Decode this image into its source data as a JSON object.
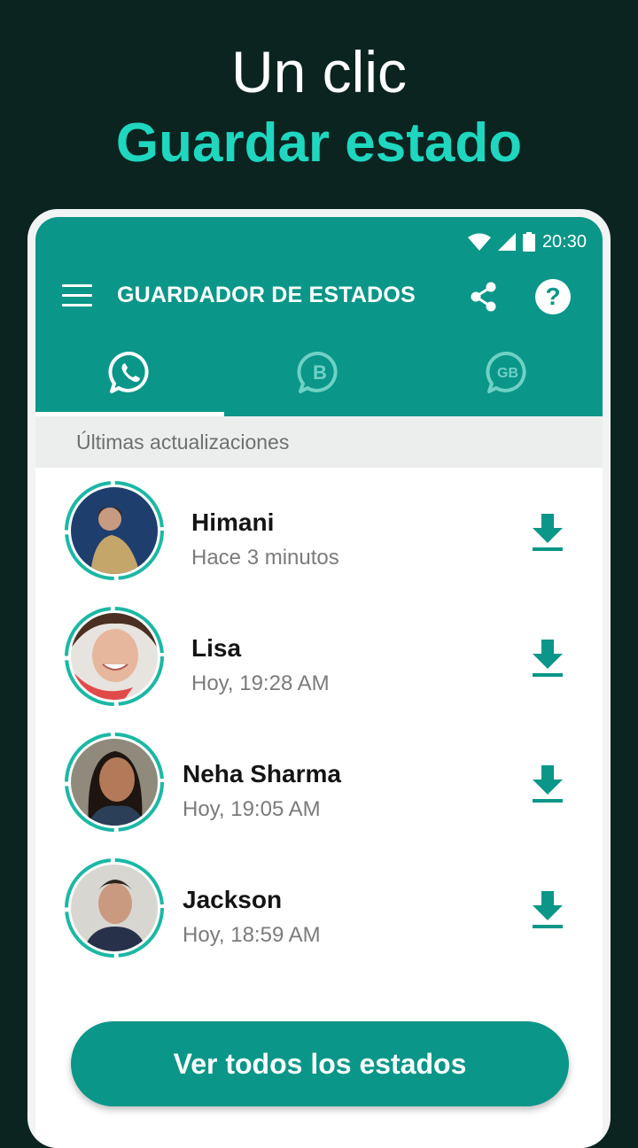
{
  "headline": {
    "line1": "Un clic",
    "line2": "Guardar estado"
  },
  "status_bar": {
    "time": "20:30",
    "icons": [
      "wifi-icon",
      "signal-icon",
      "battery-icon"
    ]
  },
  "toolbar": {
    "title": "GUARDADOR DE ESTADOS",
    "icons": [
      "menu-icon",
      "share-icon",
      "help-icon"
    ]
  },
  "tabs": [
    {
      "icon": "whatsapp-icon",
      "active": true
    },
    {
      "icon": "whatsapp-business-icon",
      "badge": "B",
      "active": false
    },
    {
      "icon": "gb-whatsapp-icon",
      "badge": "GB",
      "active": false
    }
  ],
  "section": {
    "title": "Últimas actualizaciones"
  },
  "statuses": [
    {
      "name": "Himani",
      "time": "Hace 3 minutos"
    },
    {
      "name": "Lisa",
      "time": "Hoy, 19:28 AM"
    },
    {
      "name": "Neha Sharma",
      "time": "Hoy, 19:05 AM"
    },
    {
      "name": "Jackson",
      "time": "Hoy, 18:59 AM"
    }
  ],
  "cta": {
    "label": "Ver todos los estados"
  },
  "colors": {
    "primary": "#0a9688",
    "accent": "#1fd6bf",
    "background": "#0b2420"
  }
}
